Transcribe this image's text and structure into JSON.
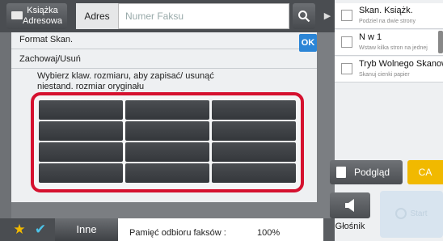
{
  "topbar": {
    "address_book": "Książka Adresowa",
    "address_label": "Adres",
    "fax_placeholder": "Numer Faksu",
    "search_icon": "search-icon",
    "forward_icon": "arrow-forward-icon"
  },
  "right_panel": {
    "items": [
      {
        "title": "Skan. Książk.",
        "desc": "Podziel na dwie strony"
      },
      {
        "title": "N w 1",
        "desc": "Wstaw kilka stron na jednej"
      },
      {
        "title": "Tryb Wolnego Skanowania",
        "desc": "Skanuj cienki papier"
      }
    ],
    "preview_label": "Podgląd",
    "ca_label": "CA",
    "speaker_label": "Głośnik",
    "start_label": "Start"
  },
  "dialog": {
    "title": "Format Skan.",
    "subtitle": "Zachowaj/Usuń",
    "ok_label": "OK",
    "instruction": "Wybierz klaw. rozmiaru, aby zapisać/ usunąć niestand. rozmiar oryginału",
    "size_key_count": 12,
    "highlight_color": "#d5112f"
  },
  "bottombar": {
    "other_label": "Inne",
    "memory_label": "Pamięć odbioru faksów :",
    "memory_value": "100%"
  },
  "colors": {
    "accent_blue": "#2b85d6",
    "ca_yellow": "#f1b900",
    "check_cyan": "#4dc3e8"
  }
}
